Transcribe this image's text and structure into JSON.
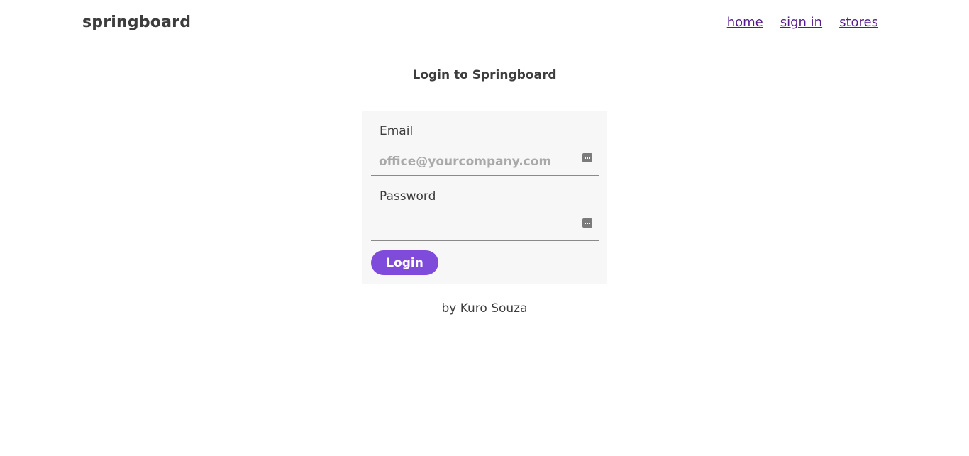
{
  "header": {
    "brand": "springboard",
    "nav": [
      {
        "label": "home"
      },
      {
        "label": "sign in"
      },
      {
        "label": "stores"
      }
    ],
    "link_color": "#551a8b"
  },
  "main": {
    "title": "Login to Springboard",
    "form": {
      "email": {
        "label": "Email",
        "value": "",
        "placeholder": "office@yourcompany.com",
        "icon": "password-manager-icon"
      },
      "password": {
        "label": "Password",
        "value": "",
        "placeholder": "",
        "icon": "password-manager-icon"
      },
      "submit_label": "Login",
      "accent_color": "#7f4bdb",
      "card_background": "#f7f7f7"
    }
  },
  "footer": {
    "credit": "by Kuro Souza"
  }
}
